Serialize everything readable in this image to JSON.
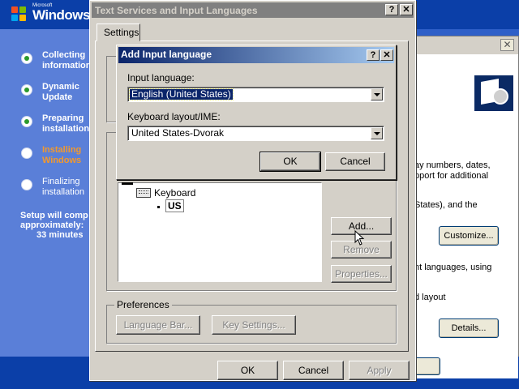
{
  "setup": {
    "logo_small": "Microsoft",
    "logo_text": "Windows",
    "steps": [
      {
        "line1": "Collecting",
        "line2": "information",
        "state": "done"
      },
      {
        "line1": "Dynamic",
        "line2": "Update",
        "state": "done"
      },
      {
        "line1": "Preparing",
        "line2": "installation",
        "state": "done"
      },
      {
        "line1": "Installing",
        "line2": "Windows",
        "state": "current"
      },
      {
        "line1": "Finalizing",
        "line2": "installation",
        "state": "pending"
      }
    ],
    "estimate_line1": "Setup will comp",
    "estimate_line2": "approximately:",
    "estimate_line3": "33 minutes"
  },
  "regional": {
    "close_glyph": "✕",
    "text1": "ay numbers, dates,",
    "text2": "pport for additional",
    "text3": "States), and the",
    "customize_label": "Customize...",
    "text4": "nt languages, using",
    "text5": "d layout",
    "details_label": "Details..."
  },
  "text_services": {
    "title": "Text Services and Input Languages",
    "help_glyph": "?",
    "close_glyph": "✕",
    "tab_settings": "Settings",
    "tree_keyboard": "Keyboard",
    "tree_us": "US",
    "add_label": "Add...",
    "remove_label": "Remove",
    "properties_label": "Properties...",
    "preferences_label": "Preferences",
    "language_bar_label": "Language Bar...",
    "key_settings_label": "Key Settings...",
    "ok_label": "OK",
    "cancel_label": "Cancel",
    "apply_label": "Apply"
  },
  "add_dialog": {
    "title": "Add Input language",
    "help_glyph": "?",
    "close_glyph": "✕",
    "input_language_label": "Input language:",
    "input_language_value": "English (United States)",
    "keyboard_layout_label": "Keyboard layout/IME:",
    "keyboard_layout_value": "United States-Dvorak",
    "ok_label": "OK",
    "cancel_label": "Cancel"
  },
  "colors": {
    "active_title_start": "#0a246a",
    "active_title_end": "#a6caf0",
    "inactive_title": "#808080",
    "setup_current_step": "#f2992e"
  }
}
